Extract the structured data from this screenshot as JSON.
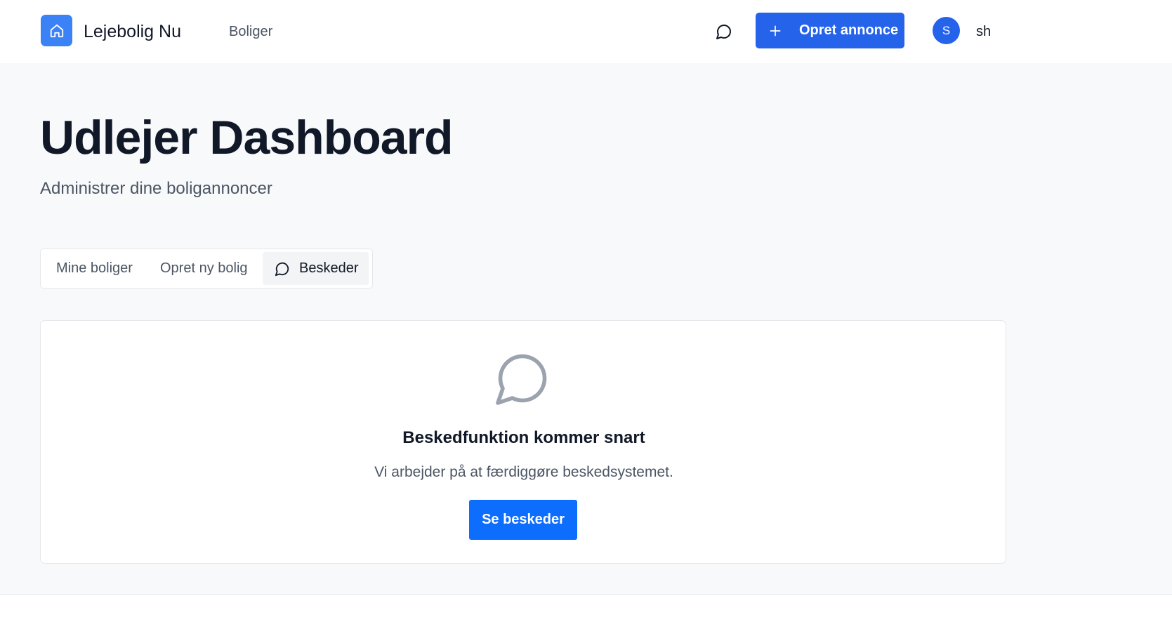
{
  "header": {
    "brand": "Lejebolig Nu",
    "nav_link": "Boliger",
    "create_button": "Opret annonce",
    "avatar_initial": "S",
    "username": "sh",
    "icons": {
      "logo": "home-icon",
      "messages": "message-circle-icon",
      "create": "plus-icon"
    }
  },
  "page": {
    "title": "Udlejer Dashboard",
    "subtitle": "Administrer dine boligannoncer"
  },
  "tabs": [
    {
      "label": "Mine boliger",
      "active": false
    },
    {
      "label": "Opret ny bolig",
      "active": false
    },
    {
      "label": "Beskeder",
      "active": true,
      "icon": "message-circle-icon"
    }
  ],
  "card": {
    "icon": "message-circle-icon",
    "title": "Beskedfunktion kommer snart",
    "text": "Vi arbejder på at færdiggøre beskedsystemet.",
    "button": "Se beskeder"
  },
  "colors": {
    "primary": "#2563eb",
    "logo_bg": "#3b82f6",
    "card_button": "#0d6efd",
    "page_bg": "#f8f9fb"
  }
}
